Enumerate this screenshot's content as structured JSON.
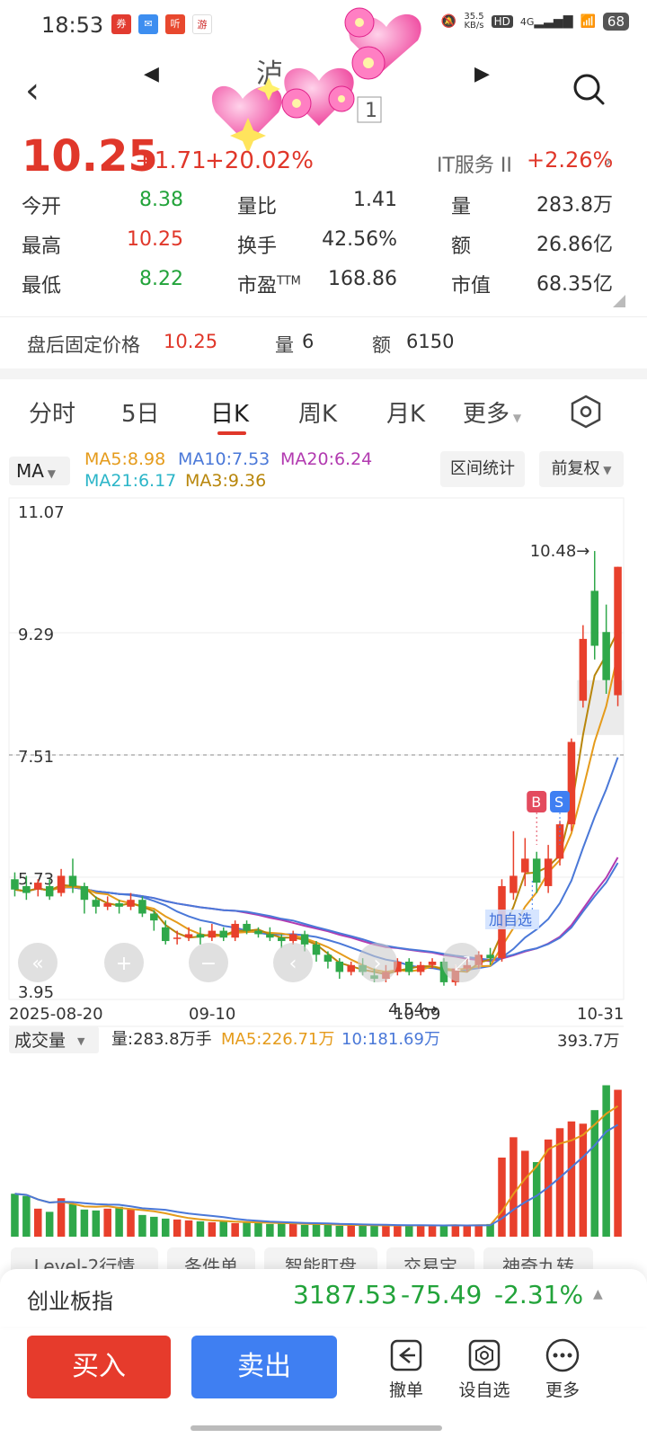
{
  "status": {
    "time": "18:53",
    "net_speed": "35.5",
    "net_unit": "KB/s",
    "hd": "HD",
    "signal": "4G",
    "battery": "68"
  },
  "header": {
    "back": "‹",
    "prev": "◀",
    "next": "▶",
    "title_fragment": "1"
  },
  "quote": {
    "price": "10.25",
    "change": "+1.71",
    "change_pct": "+20.02%",
    "sector": "IT服务 II",
    "sector_pct": "+2.26%",
    "rows": [
      {
        "l1": "今开",
        "v1": "8.38",
        "l2": "量比",
        "v2": "1.41",
        "l3": "量",
        "v3": "283.8万"
      },
      {
        "l1": "最高",
        "v1": "10.25",
        "l2": "换手",
        "v2": "42.56%",
        "l3": "额",
        "v3": "26.86亿"
      },
      {
        "l1": "最低",
        "v1": "8.22",
        "l2": "市盈",
        "l2sup": "TTM",
        "v2": "168.86",
        "l3": "市值",
        "v3": "68.35亿"
      }
    ]
  },
  "after_hours": {
    "label": "盘后固定价格",
    "price": "10.25",
    "vol_label": "量",
    "vol": "6",
    "amt_label": "额",
    "amt": "6150"
  },
  "tabs": [
    "分时",
    "5日",
    "日K",
    "周K",
    "月K",
    "更多"
  ],
  "ma": {
    "button": "MA",
    "ma5": "MA5:8.98",
    "ma10": "MA10:7.53",
    "ma20": "MA20:6.24",
    "ma21": "MA21:6.17",
    "ma3": "MA3:9.36",
    "range_stats": "区间统计",
    "adjust": "前复权"
  },
  "chart_data": {
    "type": "candlestick",
    "y_ticks": [
      "11.07",
      "9.29",
      "7.51",
      "5.73",
      "3.95"
    ],
    "ylim": [
      3.95,
      11.07
    ],
    "x_ticks": [
      "2025-08-20",
      "09-10",
      "10-09",
      "10-31"
    ],
    "high_annotation": "10.48→",
    "low_annotation": "4.54→",
    "dashed_level": 7.51,
    "markers": {
      "buy": "B",
      "sell": "S",
      "add_watch": "加自选"
    },
    "candles": [
      [
        5.7,
        5.55,
        5.8,
        5.45
      ],
      [
        5.6,
        5.5,
        5.75,
        5.4
      ],
      [
        5.55,
        5.65,
        5.7,
        5.45
      ],
      [
        5.6,
        5.45,
        5.7,
        5.4
      ],
      [
        5.5,
        5.75,
        5.85,
        5.45
      ],
      [
        5.75,
        5.6,
        6.0,
        5.5
      ],
      [
        5.6,
        5.4,
        5.65,
        5.2
      ],
      [
        5.4,
        5.3,
        5.45,
        5.2
      ],
      [
        5.3,
        5.35,
        5.45,
        5.25
      ],
      [
        5.35,
        5.3,
        5.4,
        5.2
      ],
      [
        5.3,
        5.4,
        5.5,
        5.25
      ],
      [
        5.4,
        5.2,
        5.45,
        5.15
      ],
      [
        5.2,
        5.1,
        5.25,
        4.95
      ],
      [
        5.0,
        4.8,
        5.1,
        4.75
      ],
      [
        4.85,
        4.85,
        4.95,
        4.75
      ],
      [
        4.85,
        4.9,
        5.0,
        4.8
      ],
      [
        4.9,
        4.85,
        5.0,
        4.75
      ],
      [
        4.85,
        4.95,
        5.05,
        4.8
      ],
      [
        4.95,
        4.85,
        5.0,
        4.8
      ],
      [
        4.85,
        5.05,
        5.1,
        4.8
      ],
      [
        5.05,
        4.95,
        5.1,
        4.9
      ],
      [
        4.95,
        4.9,
        5.0,
        4.85
      ],
      [
        4.9,
        4.85,
        5.0,
        4.8
      ],
      [
        4.85,
        4.8,
        4.9,
        4.7
      ],
      [
        4.8,
        4.9,
        4.95,
        4.75
      ],
      [
        4.9,
        4.75,
        4.95,
        4.65
      ],
      [
        4.75,
        4.6,
        4.8,
        4.5
      ],
      [
        4.6,
        4.5,
        4.65,
        4.4
      ],
      [
        4.5,
        4.35,
        4.55,
        4.25
      ],
      [
        4.35,
        4.45,
        4.5,
        4.3
      ],
      [
        4.45,
        4.35,
        4.55,
        4.3
      ],
      [
        4.3,
        4.25,
        4.4,
        4.2
      ],
      [
        4.25,
        4.35,
        4.45,
        4.2
      ],
      [
        4.35,
        4.5,
        4.55,
        4.3
      ],
      [
        4.5,
        4.35,
        4.55,
        4.3
      ],
      [
        4.35,
        4.45,
        4.5,
        4.3
      ],
      [
        4.45,
        4.5,
        4.55,
        4.4
      ],
      [
        4.5,
        4.2,
        4.55,
        4.15
      ],
      [
        4.2,
        4.4,
        4.45,
        4.15
      ],
      [
        4.4,
        4.45,
        4.55,
        4.35
      ],
      [
        4.45,
        4.6,
        4.65,
        4.4
      ],
      [
        4.6,
        4.55,
        4.7,
        4.45
      ],
      [
        4.55,
        5.6,
        5.7,
        4.5
      ],
      [
        5.5,
        5.75,
        6.4,
        5.4
      ],
      [
        5.8,
        6.0,
        6.3,
        5.6
      ],
      [
        6.0,
        5.65,
        6.1,
        5.5
      ],
      [
        5.6,
        6.0,
        6.2,
        5.5
      ],
      [
        6.0,
        6.5,
        6.55,
        5.9
      ],
      [
        6.5,
        7.7,
        7.75,
        6.4
      ],
      [
        8.3,
        9.2,
        9.4,
        8.2
      ],
      [
        9.9,
        9.1,
        10.48,
        8.9
      ],
      [
        9.3,
        8.6,
        9.7,
        8.4
      ],
      [
        8.38,
        10.25,
        10.25,
        8.22
      ]
    ],
    "volume": {
      "label": "成交量",
      "vol_text": "量:283.8万手",
      "ma5_text": "MA5:226.71万",
      "ma10_text": "10:181.69万",
      "max_label": "393.7万",
      "values": [
        95,
        90,
        62,
        55,
        85,
        72,
        60,
        58,
        62,
        66,
        60,
        48,
        44,
        40,
        38,
        36,
        34,
        32,
        34,
        30,
        32,
        30,
        28,
        30,
        28,
        26,
        28,
        26,
        24,
        26,
        24,
        26,
        24,
        24,
        26,
        24,
        26,
        24,
        26,
        24,
        26,
        28,
        175,
        220,
        190,
        165,
        215,
        240,
        255,
        250,
        280,
        335,
        325
      ]
    }
  },
  "level2_tabs": [
    "Level-2行情",
    "条件单",
    "智能盯盘",
    "交易宝",
    "神奇九转"
  ],
  "index": {
    "name": "创业板指",
    "value": "3187.53",
    "change": "-75.49",
    "pct": "-2.31%"
  },
  "bottom": {
    "buy": "买入",
    "sell": "卖出",
    "cancel": "撤单",
    "watch": "设自选",
    "more": "更多"
  }
}
